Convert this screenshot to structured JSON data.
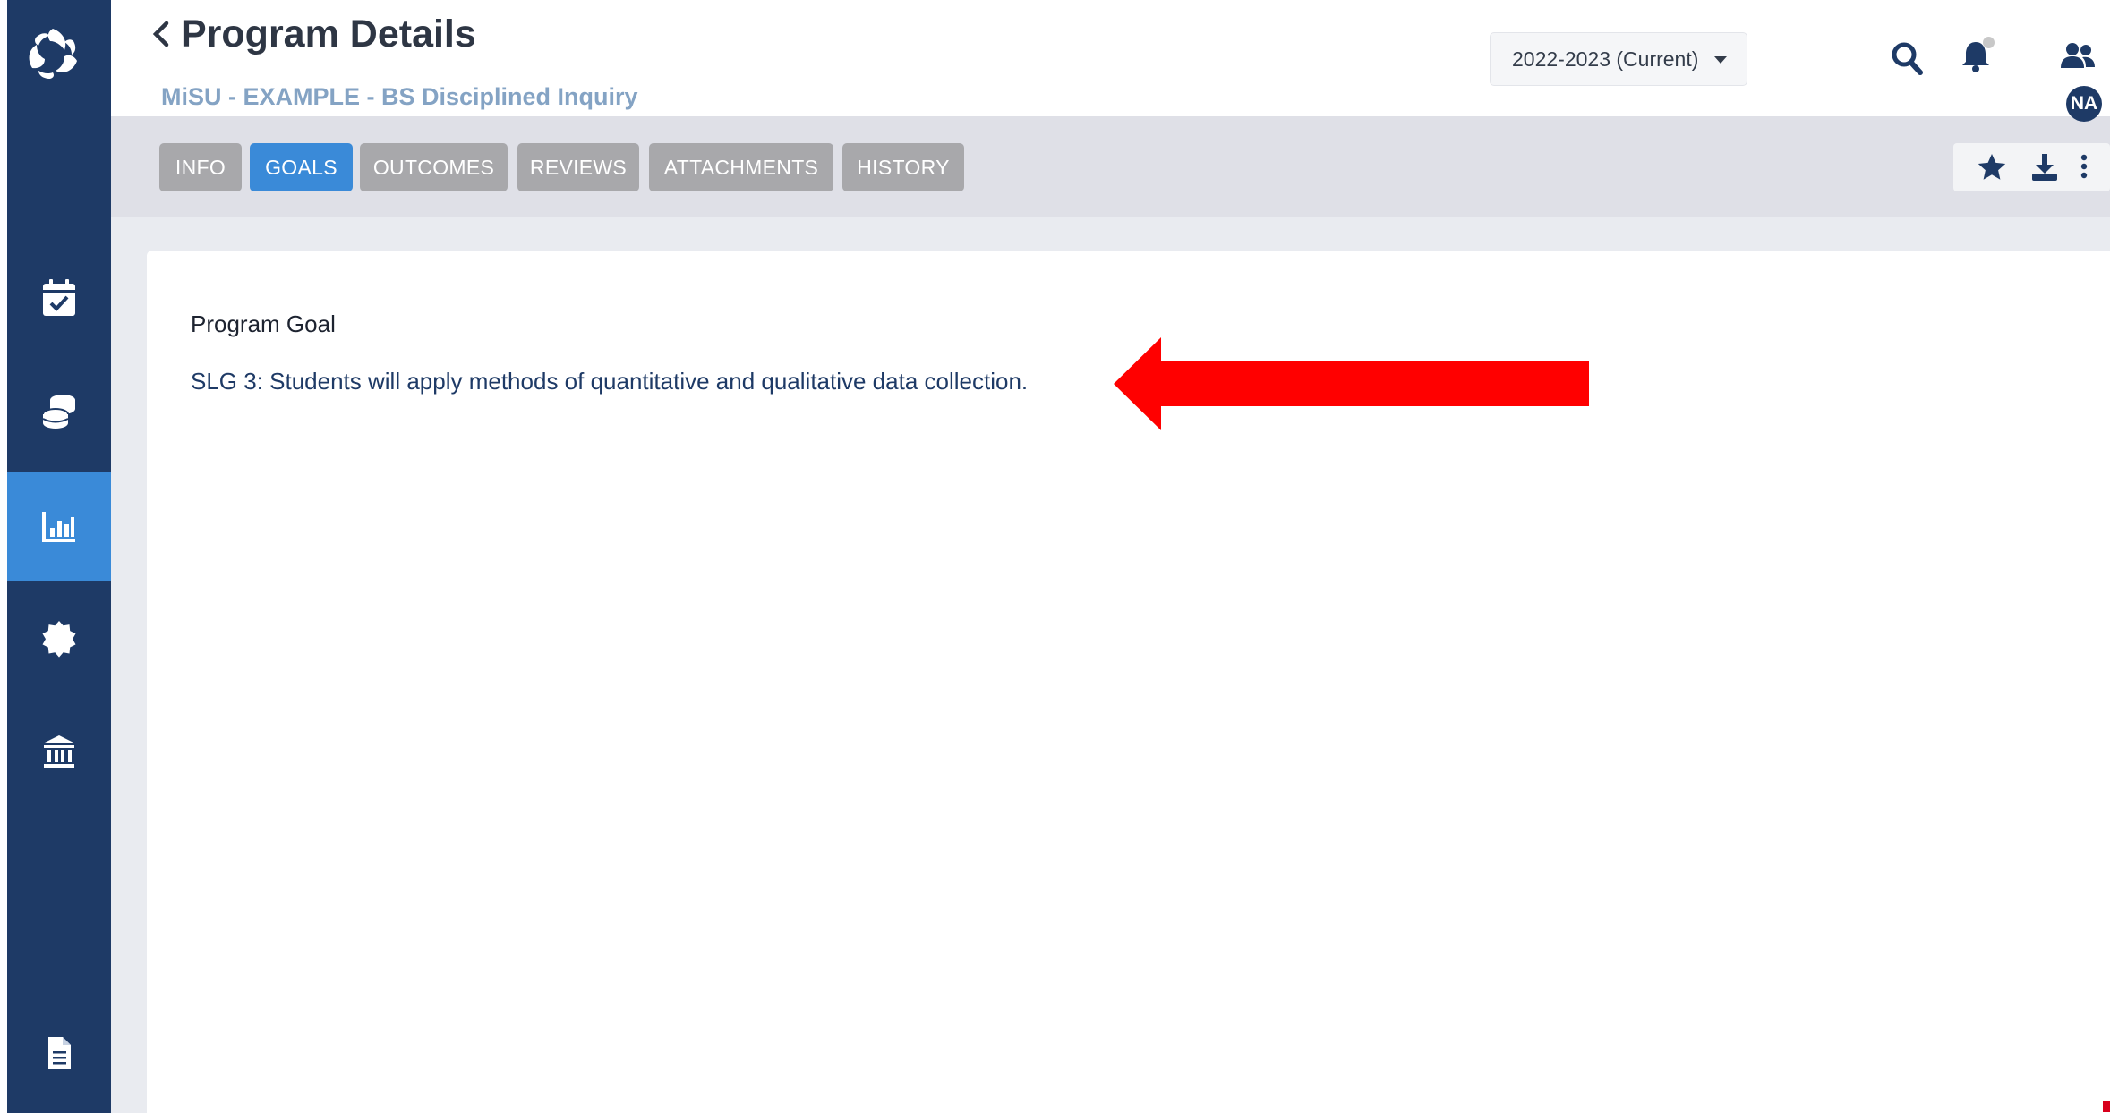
{
  "header": {
    "title": "Program Details",
    "subtitle": "MiSU - EXAMPLE - BS Disciplined Inquiry",
    "year_select": {
      "value": "2022-2023 (Current)"
    },
    "avatar_initials": "NA"
  },
  "tabs": [
    {
      "label": "INFO",
      "active": false
    },
    {
      "label": "GOALS",
      "active": true
    },
    {
      "label": "OUTCOMES",
      "active": false
    },
    {
      "label": "REVIEWS",
      "active": false
    },
    {
      "label": "ATTACHMENTS",
      "active": false
    },
    {
      "label": "HISTORY",
      "active": false
    }
  ],
  "sidebar": {
    "items": [
      {
        "icon": "calendar-check-icon",
        "active": false
      },
      {
        "icon": "coins-icon",
        "active": false
      },
      {
        "icon": "chart-bar-icon",
        "active": true
      },
      {
        "icon": "badge-icon",
        "active": false
      },
      {
        "icon": "institution-icon",
        "active": false
      },
      {
        "icon": "document-icon",
        "active": false
      }
    ]
  },
  "toolbar": {
    "icons": [
      "star-icon",
      "download-icon",
      "more-vertical-icon"
    ]
  },
  "content": {
    "goal_label": "Program Goal",
    "goal_text": "SLG 3: Students will apply methods of quantitative and qualitative data collection."
  },
  "colors": {
    "sidebar": "#1e3a66",
    "accent": "#3a8ad8",
    "tab_inactive": "#a8a8ab",
    "annotation_arrow": "#ff0000"
  }
}
